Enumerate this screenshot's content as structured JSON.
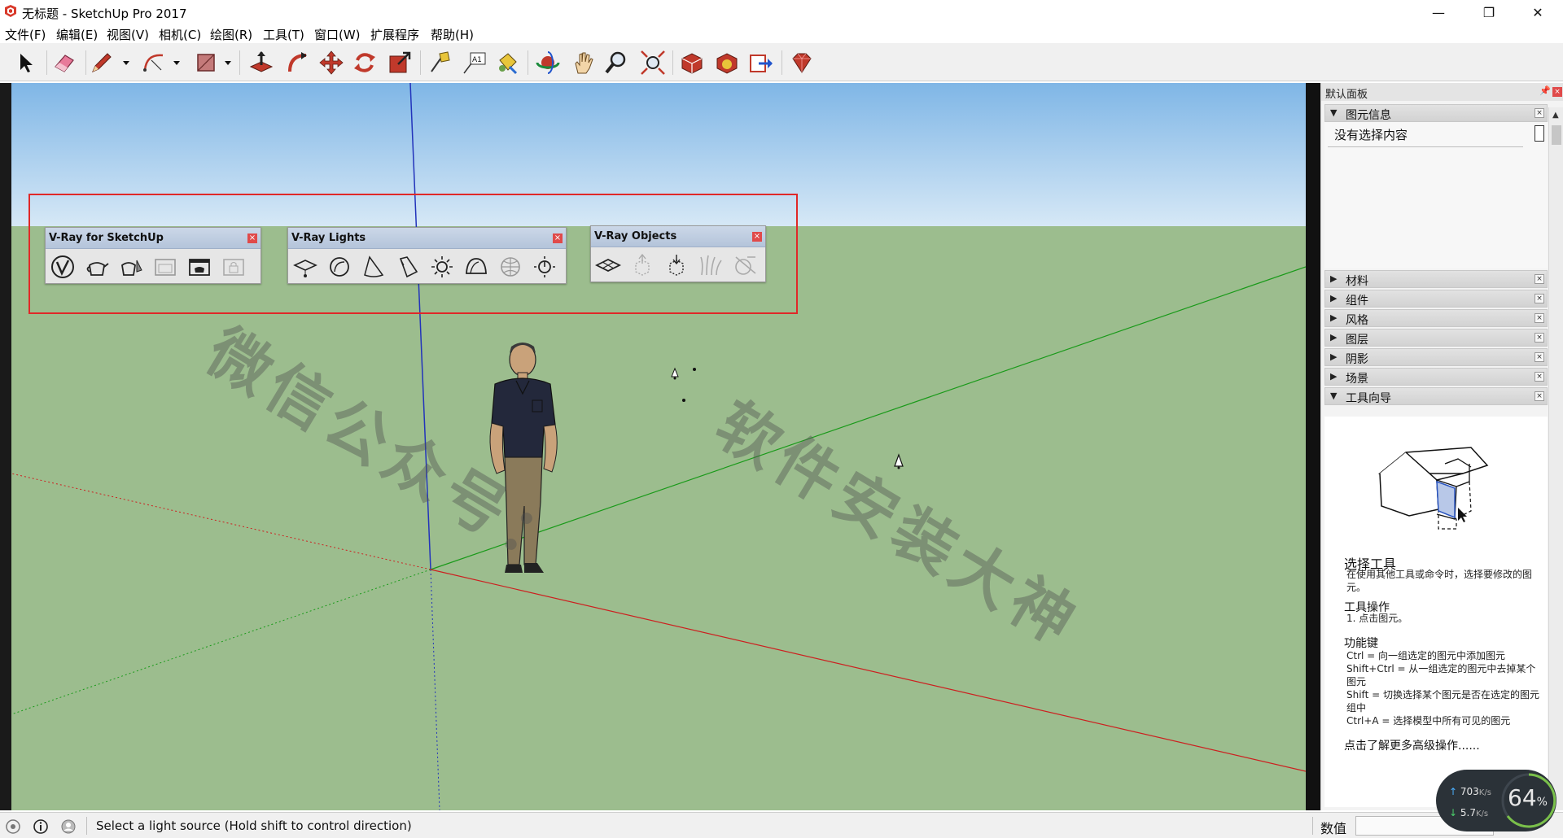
{
  "window": {
    "title": "无标题 - SketchUp Pro 2017",
    "minimize": "—",
    "maximize": "❐",
    "close": "✕"
  },
  "menu": [
    "文件(F)",
    "编辑(E)",
    "视图(V)",
    "相机(C)",
    "绘图(R)",
    "工具(T)",
    "窗口(W)",
    "扩展程序",
    "帮助(H)"
  ],
  "toolbar": {
    "icons": [
      "select-arrow-icon",
      "eraser-icon",
      "pencil-line-icon",
      "arc-icon",
      "rectangle-icon",
      "push-pull-icon",
      "follow-me-icon",
      "move-icon",
      "rotate-icon",
      "scale-icon",
      "tape-measure-icon",
      "text-label-icon",
      "paint-bucket-icon",
      "orbit-icon",
      "pan-hand-icon",
      "zoom-icon",
      "zoom-extents-icon",
      "warehouse-icon",
      "extension-warehouse-icon",
      "send-to-layout-icon",
      "ruby-icon"
    ]
  },
  "vray_toolbars": [
    {
      "title": "V-Ray for SketchUp",
      "close": "×",
      "icons": [
        "vray-logo-icon",
        "teapot-render-icon",
        "interactive-render-icon",
        "frame-buffer-icon",
        "render-window-icon",
        "batch-lock-icon"
      ]
    },
    {
      "title": "V-Ray Lights",
      "close": "×",
      "icons": [
        "rect-light-icon",
        "sphere-light-icon",
        "spot-light-icon",
        "ies-light-icon",
        "omni-light-icon",
        "dome-light-icon",
        "mesh-light-icon",
        "sun-light-icon"
      ]
    },
    {
      "title": "V-Ray Objects",
      "close": "×",
      "icons": [
        "infinite-plane-icon",
        "proxy-export-icon",
        "proxy-import-icon",
        "fur-icon",
        "clipper-icon"
      ]
    }
  ],
  "watermark": {
    "line1": "微信公众号：",
    "line2": "软件安装大神"
  },
  "panel": {
    "title": "默认面板",
    "pin": "ᵖ",
    "close": "×",
    "entity_info": {
      "label": "图元信息",
      "arrow": "▼",
      "content": "没有选择内容"
    },
    "trays": [
      {
        "label": "材料",
        "arrow": "▶"
      },
      {
        "label": "组件",
        "arrow": "▶"
      },
      {
        "label": "风格",
        "arrow": "▶"
      },
      {
        "label": "图层",
        "arrow": "▶"
      },
      {
        "label": "阴影",
        "arrow": "▶"
      },
      {
        "label": "场景",
        "arrow": "▶"
      },
      {
        "label": "工具向导",
        "arrow": "▼"
      }
    ],
    "tray_close": "×",
    "instructor": {
      "heading": "选择工具",
      "desc": "在使用其他工具或命令时，选择要修改的图元。",
      "ops_heading": "工具操作",
      "ops": "1. 点击图元。",
      "keys_heading": "功能键",
      "keys": [
        "Ctrl = 向一组选定的图元中添加图元",
        "Shift+Ctrl = 从一组选定的图元中去掉某个图元",
        "Shift = 切换选择某个图元是否在选定的图元组中",
        "Ctrl+A = 选择模型中所有可见的图元"
      ],
      "link": "点击了解更多高级操作......"
    }
  },
  "status": {
    "message": "Select a light source (Hold shift to control direction)",
    "measure_label": "数值",
    "measure_value": ""
  },
  "net": {
    "up": "703",
    "up_unit": "K/s",
    "down": "5.7",
    "down_unit": "K/s",
    "percent": "64",
    "percent_unit": "%",
    "up_arrow": "↑",
    "down_arrow": "↓"
  },
  "colors": {
    "sky_top": "#7fb6e6",
    "sky_bottom": "#d6e8f6",
    "ground": "#9cbd8e",
    "axis_red": "#cc2020",
    "axis_green": "#1a9a1a",
    "axis_blue": "#2233bb",
    "highlight": "#e02828"
  }
}
